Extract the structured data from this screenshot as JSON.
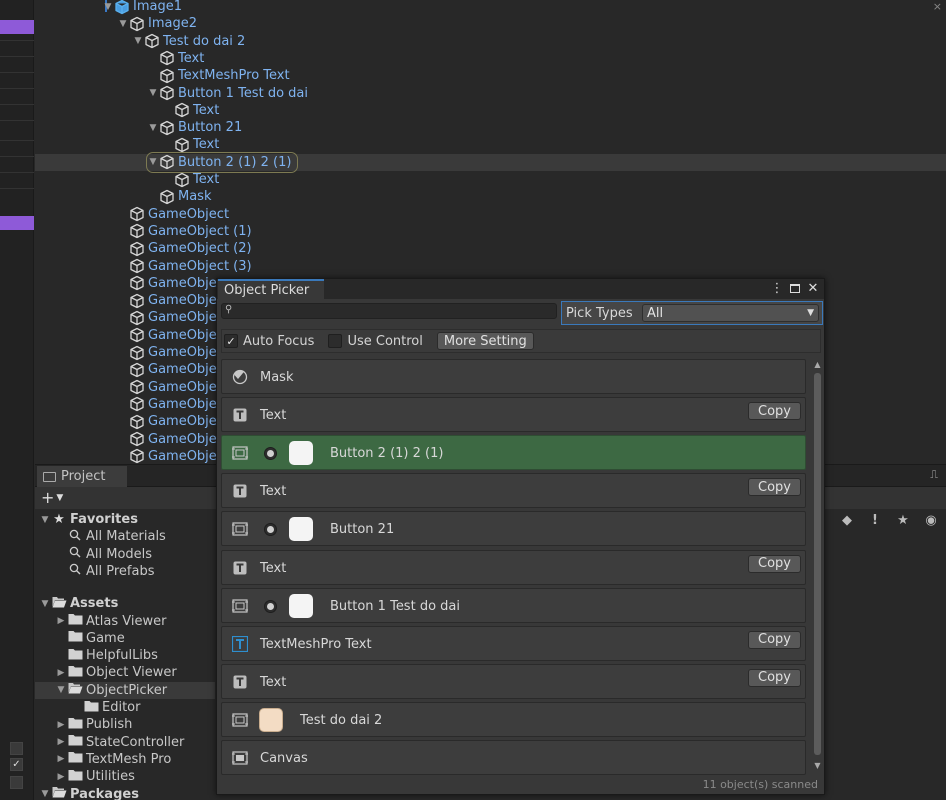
{
  "hierarchy": {
    "rows": [
      {
        "label": "Image1",
        "depth": 5,
        "arrow": "▼"
      },
      {
        "label": "Image2",
        "depth": 6,
        "arrow": "▼"
      },
      {
        "label": "Test do dai 2",
        "depth": 7,
        "arrow": "▼"
      },
      {
        "label": "Text",
        "depth": 8,
        "arrow": ""
      },
      {
        "label": "TextMeshPro Text",
        "depth": 8,
        "arrow": ""
      },
      {
        "label": "Button 1 Test do dai",
        "depth": 8,
        "arrow": "▼"
      },
      {
        "label": "Text",
        "depth": 9,
        "arrow": ""
      },
      {
        "label": "Button 21",
        "depth": 8,
        "arrow": "▼"
      },
      {
        "label": "Text",
        "depth": 9,
        "arrow": ""
      },
      {
        "label": "Button 2 (1) 2 (1)",
        "depth": 8,
        "arrow": "▼"
      },
      {
        "label": "Text",
        "depth": 9,
        "arrow": ""
      },
      {
        "label": "Mask",
        "depth": 8,
        "arrow": ""
      },
      {
        "label": "GameObject",
        "depth": 6,
        "arrow": ""
      },
      {
        "label": "GameObject (1)",
        "depth": 6,
        "arrow": ""
      },
      {
        "label": "GameObject (2)",
        "depth": 6,
        "arrow": ""
      },
      {
        "label": "GameObject (3)",
        "depth": 6,
        "arrow": ""
      },
      {
        "label": "GameObje",
        "depth": 6,
        "arrow": ""
      },
      {
        "label": "GameObje",
        "depth": 6,
        "arrow": ""
      },
      {
        "label": "GameObje",
        "depth": 6,
        "arrow": ""
      },
      {
        "label": "GameObje",
        "depth": 6,
        "arrow": ""
      },
      {
        "label": "GameObje",
        "depth": 6,
        "arrow": ""
      },
      {
        "label": "GameObje",
        "depth": 6,
        "arrow": ""
      },
      {
        "label": "GameObje",
        "depth": 6,
        "arrow": ""
      },
      {
        "label": "GameObje",
        "depth": 6,
        "arrow": ""
      },
      {
        "label": "GameObje",
        "depth": 6,
        "arrow": ""
      },
      {
        "label": "GameObje",
        "depth": 6,
        "arrow": ""
      },
      {
        "label": "GameObje",
        "depth": 6,
        "arrow": ""
      }
    ]
  },
  "project": {
    "tab_label": "Project",
    "add_label": "+",
    "rows": [
      {
        "label": "Favorites",
        "kind": "star",
        "arrow": "▼",
        "depth": 0,
        "bold": true
      },
      {
        "label": "All Materials",
        "kind": "search",
        "arrow": "",
        "depth": 1
      },
      {
        "label": "All Models",
        "kind": "search",
        "arrow": "",
        "depth": 1
      },
      {
        "label": "All Prefabs",
        "kind": "search",
        "arrow": "",
        "depth": 1
      },
      {
        "label": "",
        "kind": "gap",
        "arrow": "",
        "depth": 0
      },
      {
        "label": "Assets",
        "kind": "folder-open",
        "arrow": "▼",
        "depth": 0,
        "bold": true
      },
      {
        "label": "Atlas Viewer",
        "kind": "folder",
        "arrow": "▶",
        "depth": 1
      },
      {
        "label": "Game",
        "kind": "folder",
        "arrow": "",
        "depth": 1
      },
      {
        "label": "HelpfulLibs",
        "kind": "folder",
        "arrow": "",
        "depth": 1
      },
      {
        "label": "Object Viewer",
        "kind": "folder",
        "arrow": "▶",
        "depth": 1
      },
      {
        "label": "ObjectPicker",
        "kind": "folder-open",
        "arrow": "▼",
        "depth": 1,
        "selected": true
      },
      {
        "label": "Editor",
        "kind": "folder",
        "arrow": "",
        "depth": 2
      },
      {
        "label": "Publish",
        "kind": "folder",
        "arrow": "▶",
        "depth": 1
      },
      {
        "label": "StateController",
        "kind": "folder",
        "arrow": "▶",
        "depth": 1
      },
      {
        "label": "TextMesh Pro",
        "kind": "folder",
        "arrow": "▶",
        "depth": 1
      },
      {
        "label": "Utilities",
        "kind": "folder",
        "arrow": "▶",
        "depth": 1
      },
      {
        "label": "Packages",
        "kind": "folder-open",
        "arrow": "▼",
        "depth": 0,
        "bold": true
      }
    ]
  },
  "picker": {
    "title": "Object Picker",
    "search_value": "",
    "pick_types_label": "Pick Types",
    "pick_types_value": "All",
    "auto_focus_label": "Auto Focus",
    "auto_focus_checked": true,
    "use_control_label": "Use Control",
    "use_control_checked": false,
    "more_setting_label": "More Setting",
    "copy_label": "Copy",
    "status": "11 object(s) scanned",
    "items": [
      {
        "label": "Mask",
        "icon": "mask",
        "copy": false,
        "radio": false,
        "swatch": "",
        "active": false
      },
      {
        "label": "Text",
        "icon": "text",
        "copy": true,
        "radio": false,
        "swatch": "",
        "active": false
      },
      {
        "label": "Button 2 (1) 2 (1)",
        "icon": "image",
        "copy": false,
        "radio": true,
        "swatch": "#f4f4f4",
        "active": true
      },
      {
        "label": "Text",
        "icon": "text",
        "copy": true,
        "radio": false,
        "swatch": "",
        "active": false
      },
      {
        "label": "Button 21",
        "icon": "image",
        "copy": false,
        "radio": true,
        "swatch": "#f4f4f4",
        "active": false
      },
      {
        "label": "Text",
        "icon": "text",
        "copy": true,
        "radio": false,
        "swatch": "",
        "active": false
      },
      {
        "label": "Button 1 Test do dai",
        "icon": "image",
        "copy": false,
        "radio": true,
        "swatch": "#f4f4f4",
        "active": false
      },
      {
        "label": "TextMeshPro Text",
        "icon": "tmp",
        "copy": true,
        "radio": false,
        "swatch": "",
        "active": false
      },
      {
        "label": "Text",
        "icon": "text",
        "copy": true,
        "radio": false,
        "swatch": "",
        "active": false
      },
      {
        "label": "Test do dai 2",
        "icon": "image",
        "copy": false,
        "radio": false,
        "swatch": "#f3dcc4",
        "active": false
      },
      {
        "label": "Canvas",
        "icon": "canvas",
        "copy": false,
        "radio": false,
        "swatch": "",
        "active": false
      }
    ]
  },
  "colors": {
    "accent": "#3a79bb",
    "active_row": "#3d6943",
    "hierarchy_text": "#7fb3f0",
    "purple_tab": "#8e5ad8"
  }
}
